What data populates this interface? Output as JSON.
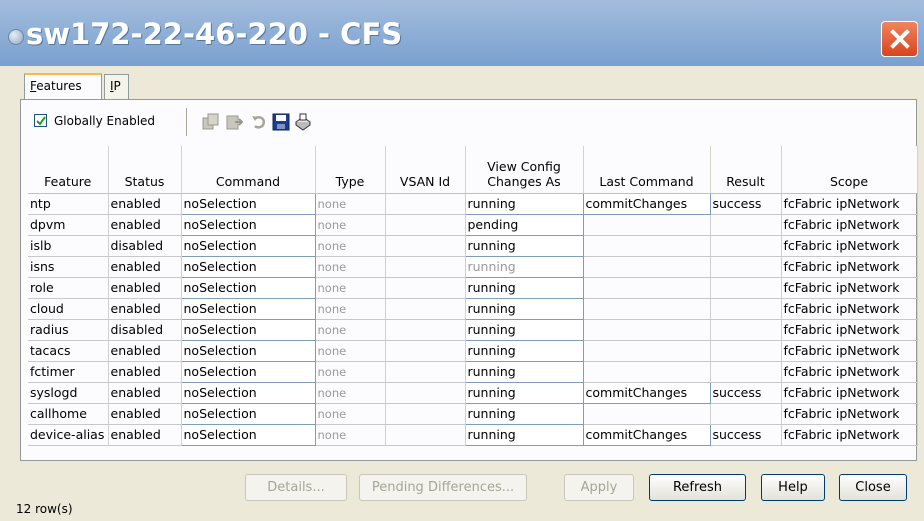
{
  "window": {
    "title": "sw172-22-46-220 - CFS"
  },
  "tabs": [
    {
      "label": "Features",
      "accel": "F",
      "rest": "eatures",
      "active": true
    },
    {
      "label": "IP",
      "accel": "I",
      "rest": "P",
      "active": false
    }
  ],
  "toolbar": {
    "globally_enabled_label": "Globally Enabled",
    "globally_enabled_checked": true,
    "icons": [
      "copy-icon",
      "paste-icon",
      "undo-icon",
      "save-icon",
      "print-icon"
    ]
  },
  "table": {
    "columns": [
      "Feature",
      "Status",
      "Command",
      "Type",
      "VSAN Id",
      "View Config Changes As",
      "Last Command",
      "Result",
      "Scope"
    ],
    "column_lines": [
      [
        "Feature"
      ],
      [
        "Status"
      ],
      [
        "Command"
      ],
      [
        "Type"
      ],
      [
        "VSAN Id"
      ],
      [
        "View Config",
        "Changes As"
      ],
      [
        "Last Command"
      ],
      [
        "Result"
      ],
      [
        "Scope"
      ]
    ],
    "rows": [
      [
        "ntp",
        "enabled",
        "noSelection",
        "none",
        "",
        "running",
        "commitChanges",
        "success",
        "fcFabric ipNetwork"
      ],
      [
        "dpvm",
        "enabled",
        "noSelection",
        "none",
        "",
        "pending",
        "",
        "",
        "fcFabric ipNetwork"
      ],
      [
        "islb",
        "disabled",
        "noSelection",
        "none",
        "",
        "running",
        "",
        "",
        "fcFabric ipNetwork"
      ],
      [
        "isns",
        "enabled",
        "noSelection",
        "none",
        "",
        "running",
        "",
        "",
        "fcFabric ipNetwork"
      ],
      [
        "role",
        "enabled",
        "noSelection",
        "none",
        "",
        "running",
        "",
        "",
        "fcFabric ipNetwork"
      ],
      [
        "cloud",
        "enabled",
        "noSelection",
        "none",
        "",
        "running",
        "",
        "",
        "fcFabric ipNetwork"
      ],
      [
        "radius",
        "disabled",
        "noSelection",
        "none",
        "",
        "running",
        "",
        "",
        "fcFabric ipNetwork"
      ],
      [
        "tacacs",
        "enabled",
        "noSelection",
        "none",
        "",
        "running",
        "",
        "",
        "fcFabric ipNetwork"
      ],
      [
        "fctimer",
        "enabled",
        "noSelection",
        "none",
        "",
        "running",
        "",
        "",
        "fcFabric ipNetwork"
      ],
      [
        "syslogd",
        "enabled",
        "noSelection",
        "none",
        "",
        "running",
        "commitChanges",
        "success",
        "fcFabric ipNetwork"
      ],
      [
        "callhome",
        "enabled",
        "noSelection",
        "none",
        "",
        "running",
        "",
        "",
        "fcFabric ipNetwork"
      ],
      [
        "device-alias",
        "enabled",
        "noSelection",
        "none",
        "",
        "running",
        "commitChanges",
        "success",
        "fcFabric ipNetwork"
      ]
    ]
  },
  "buttons": {
    "details": "Details...",
    "pending_differences": "Pending Differences...",
    "apply": "Apply",
    "refresh": "Refresh",
    "help": "Help",
    "close": "Close"
  },
  "status": {
    "row_count": "12 row(s)"
  },
  "colors": {
    "title_bar": "#7aa0cf",
    "close_button": "#d9441d",
    "tab_highlight": "#f6bb46"
  }
}
